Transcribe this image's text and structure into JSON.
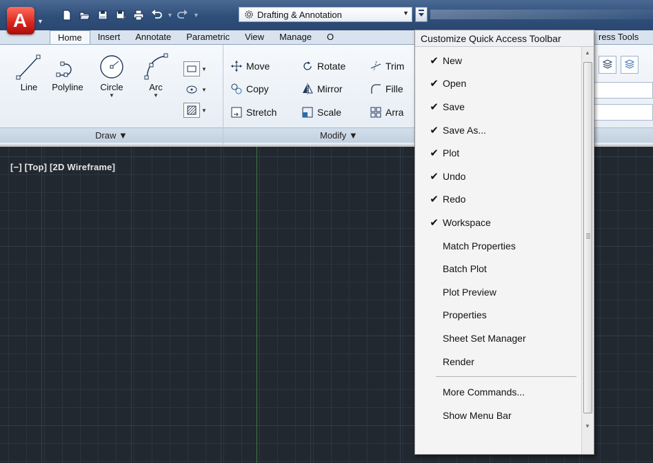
{
  "qat": {
    "icons": [
      "new-icon",
      "open-icon",
      "save-icon",
      "save-as-icon",
      "plot-icon",
      "undo-icon",
      "redo-icon"
    ],
    "workspace_value": "Drafting & Annotation"
  },
  "tabs": [
    "Home",
    "Insert",
    "Annotate",
    "Parametric",
    "View",
    "Manage",
    "O"
  ],
  "tab_express_partial": "ress Tools",
  "ribbon": {
    "draw": {
      "tools": [
        "Line",
        "Polyline",
        "Circle",
        "Arc"
      ],
      "footer": "Draw ▼"
    },
    "modify": {
      "col1": [
        "Move",
        "Copy",
        "Stretch"
      ],
      "col2": [
        "Rotate",
        "Mirror",
        "Scale"
      ],
      "col3": [
        "Trim",
        "Fille",
        "Arra"
      ],
      "footer": "Modify ▼"
    }
  },
  "viewport": {
    "label": "[−] [Top] [2D Wireframe]"
  },
  "qat_menu": {
    "title": "Customize Quick Access Toolbar",
    "checked_items": [
      "New",
      "Open",
      "Save",
      "Save As...",
      "Plot",
      "Undo",
      "Redo",
      "Workspace"
    ],
    "unchecked_items": [
      "Match Properties",
      "Batch Plot",
      "Plot Preview",
      "Properties",
      "Sheet Set Manager",
      "Render"
    ],
    "more_items": [
      "More Commands...",
      "Show Menu Bar"
    ],
    "check_glyph": "✔"
  },
  "colors": {
    "title_bar": "#2f4f7a",
    "drawing_bg": "#212830",
    "ucs_axis": "#3a7c3a",
    "menu_bg": "#f4f4f4"
  }
}
